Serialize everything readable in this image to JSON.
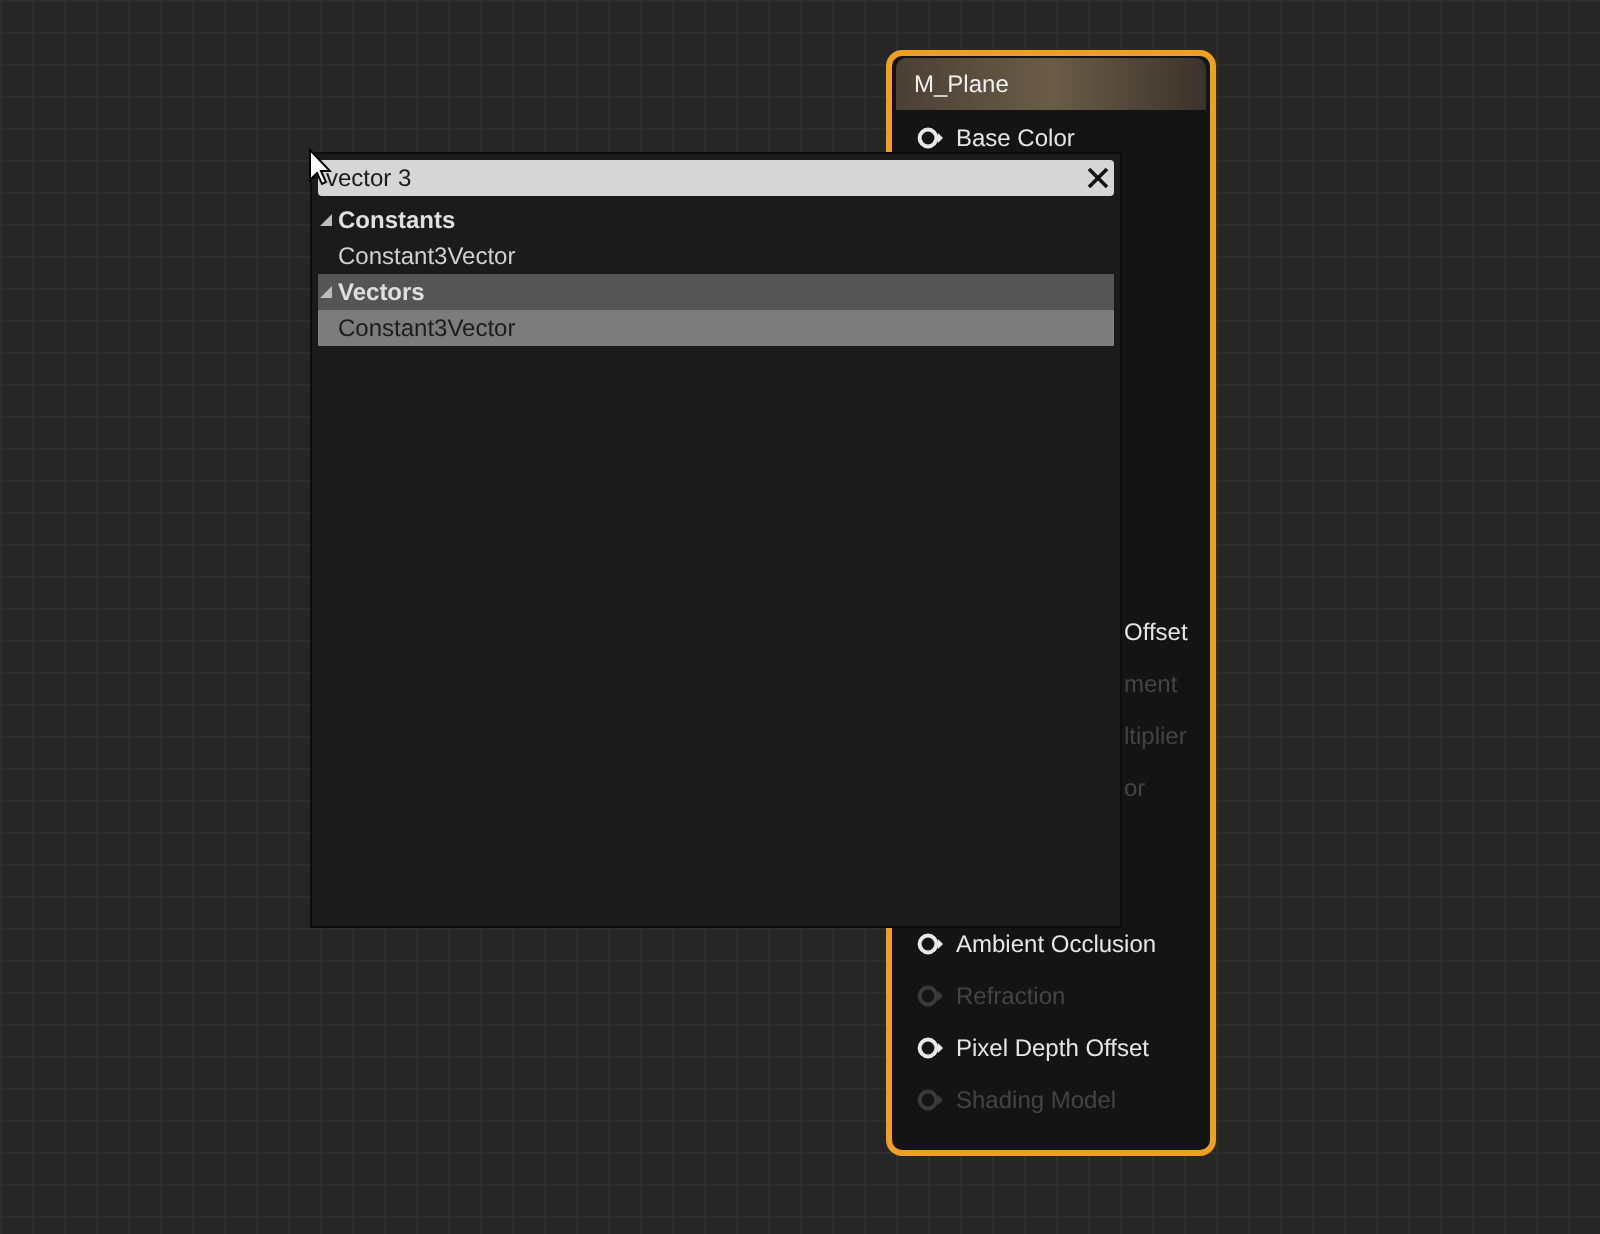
{
  "node": {
    "title": "M_Plane",
    "top_pins": [
      {
        "label": "Base Color",
        "enabled": true
      }
    ],
    "partial_pins": [
      {
        "label": "Offset",
        "enabled": true
      },
      {
        "label": "ment",
        "enabled": false
      },
      {
        "label": "ltiplier",
        "enabled": false
      },
      {
        "label": "or",
        "enabled": false
      }
    ],
    "bottom_pins": [
      {
        "label": "Ambient Occlusion",
        "enabled": true
      },
      {
        "label": "Refraction",
        "enabled": false
      },
      {
        "label": "Pixel Depth Offset",
        "enabled": true
      },
      {
        "label": "Shading Model",
        "enabled": false
      }
    ]
  },
  "popup": {
    "search": {
      "value": "vector 3"
    },
    "categories": [
      {
        "label": "Constants",
        "expanded": true,
        "selected": false,
        "items": [
          {
            "label": "Constant3Vector",
            "selected": false
          }
        ]
      },
      {
        "label": "Vectors",
        "expanded": true,
        "selected": true,
        "items": [
          {
            "label": "Constant3Vector",
            "selected": true
          }
        ]
      }
    ]
  }
}
